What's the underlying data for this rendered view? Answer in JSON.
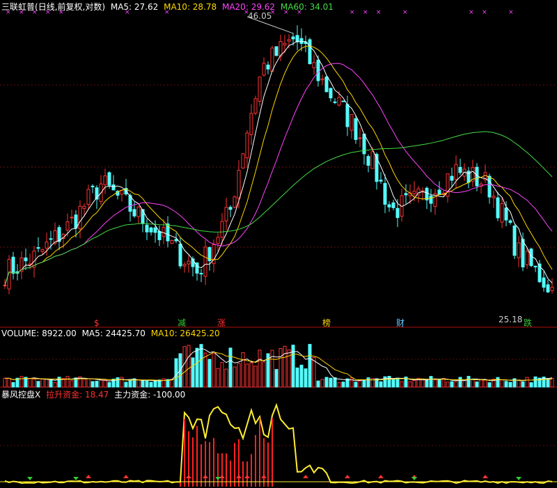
{
  "chart_data": [
    {
      "type": "candlestick",
      "stock_name": "三联虹普",
      "title_paren": "(日线,前复权,对数)",
      "scale": "log",
      "grid": true,
      "ma": [
        {
          "name": "MA5",
          "value": "27.62",
          "color": "#ffffff"
        },
        {
          "name": "MA10",
          "value": "28.78",
          "color": "#ffd700"
        },
        {
          "name": "MA20",
          "value": "29.62",
          "color": "#ff44ff"
        },
        {
          "name": "MA60",
          "value": "34.01",
          "color": "#44dd44"
        }
      ],
      "high_marker": "46.05",
      "low_marker": "25.18",
      "signal_marks": [
        {
          "text": "$",
          "color": "#ff3333"
        },
        {
          "text": "减",
          "color": "#33cc33"
        },
        {
          "text": "涨",
          "color": "#ff3333"
        },
        {
          "text": "榜",
          "color": "#ffd700"
        },
        {
          "text": "财",
          "color": "#66ccff"
        },
        {
          "text": "跌",
          "color": "#33cc33"
        }
      ],
      "approx_close_path": [
        26,
        27,
        29,
        32,
        30,
        28,
        26,
        30,
        42,
        45,
        40,
        36,
        30,
        31,
        33,
        32,
        27,
        25
      ],
      "ma_current": {
        "MA5": 27.62,
        "MA10": 28.78,
        "MA20": 29.62,
        "MA60": 34.01
      }
    },
    {
      "type": "bar",
      "title": "VOLUME",
      "series": [
        {
          "name": "VOLUME",
          "value": "8922.00",
          "color": "#ffffff"
        },
        {
          "name": "MA5",
          "value": "24425.70",
          "color": "#ffffff"
        },
        {
          "name": "MA10",
          "value": "26425.20",
          "color": "#ffd700"
        }
      ]
    },
    {
      "type": "line",
      "title": "暴风控盘X",
      "series": [
        {
          "name": "拉升资金",
          "value": "18.47",
          "color": "#ff3333"
        },
        {
          "name": "主力资金",
          "value": "-100.00",
          "color": "#ffffff"
        }
      ]
    }
  ]
}
